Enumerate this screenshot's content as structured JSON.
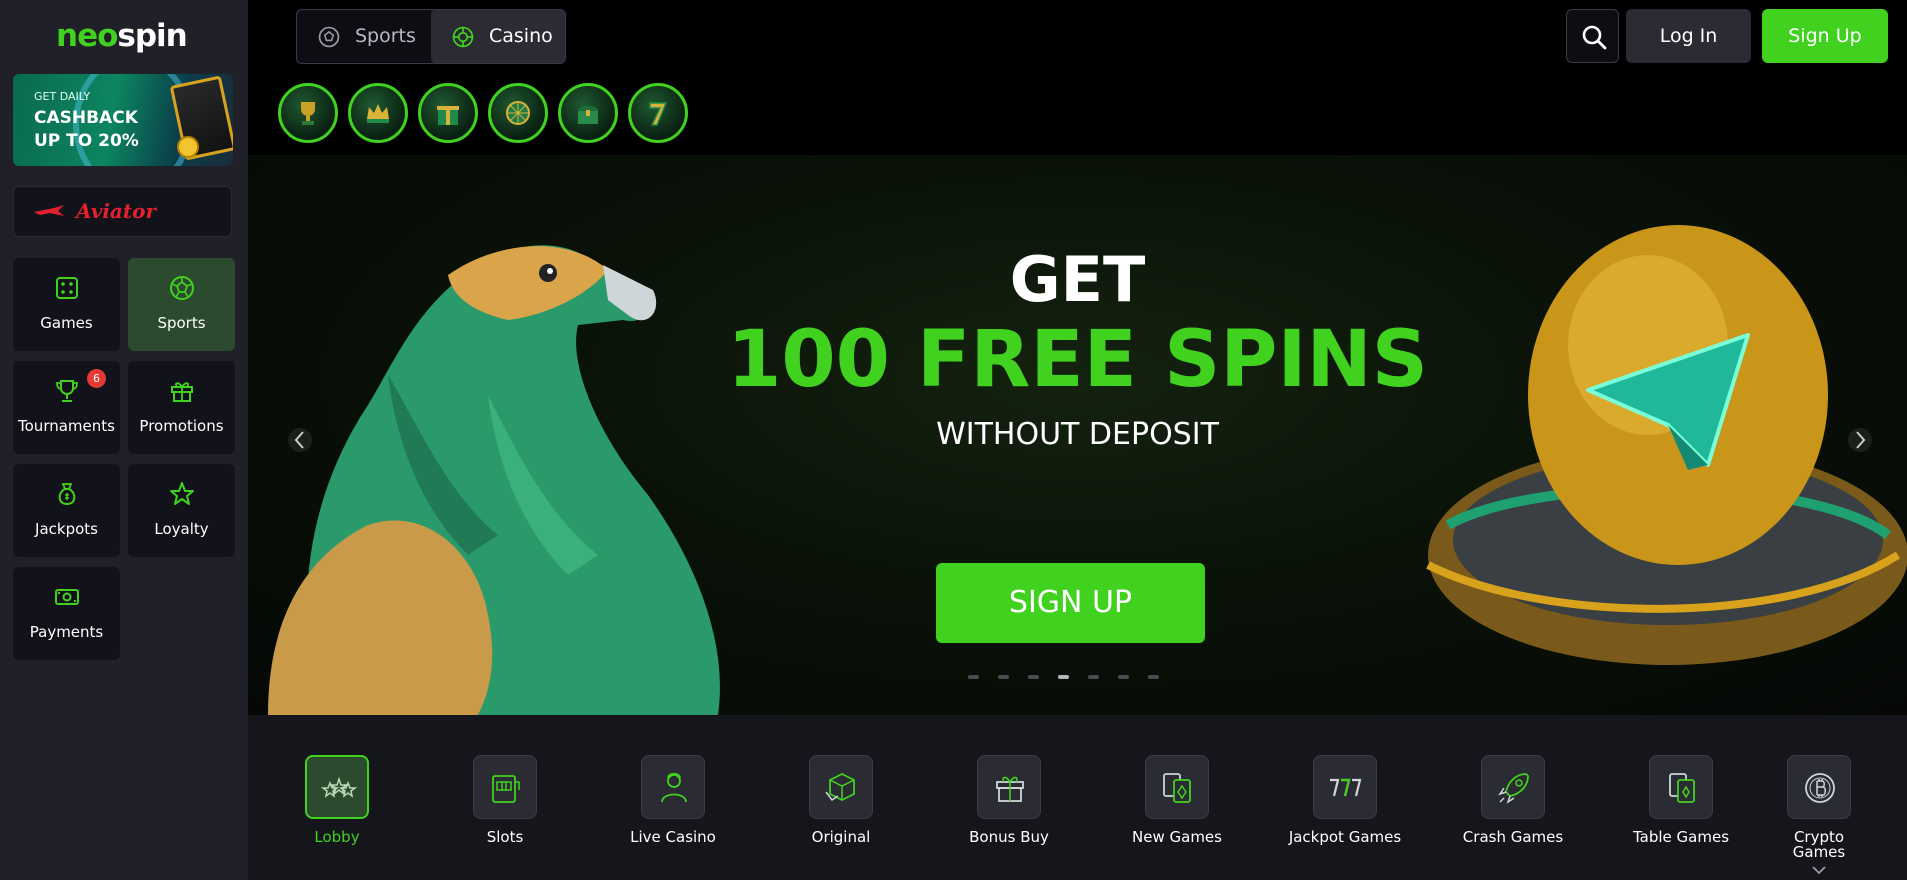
{
  "brand": {
    "part1": "neo",
    "part2": "spin"
  },
  "sidebar": {
    "cashback": {
      "line1": "GET DAILY",
      "line2": "CASHBACK",
      "line3": "UP TO 20%"
    },
    "aviator": "Aviator",
    "tiles": [
      {
        "label": "Games",
        "icon": "dice-icon"
      },
      {
        "label": "Sports",
        "icon": "soccer-ball-icon",
        "active": true
      },
      {
        "label": "Tournaments",
        "icon": "trophy-icon",
        "badge": "6"
      },
      {
        "label": "Promotions",
        "icon": "gift-icon"
      },
      {
        "label": "Jackpots",
        "icon": "money-bag-icon"
      },
      {
        "label": "Loyalty",
        "icon": "star-icon"
      },
      {
        "label": "Payments",
        "icon": "cash-icon"
      }
    ]
  },
  "header": {
    "switch": {
      "sports": "Sports",
      "casino": "Casino",
      "selected": "Casino"
    },
    "login": "Log In",
    "signup": "Sign Up"
  },
  "stories": [
    "trophy-story",
    "crown-story",
    "gift-story",
    "wheel-story",
    "chest-story",
    "seven-story"
  ],
  "hero": {
    "line1": "GET",
    "line2": "100 FREE SPINS",
    "line3": "WITHOUT DEPOSIT",
    "cta": "SIGN UP",
    "slides": 7,
    "active_slide": 4
  },
  "categories": [
    {
      "label": "Lobby",
      "active": true
    },
    {
      "label": "Slots"
    },
    {
      "label": "Live Casino"
    },
    {
      "label": "Original"
    },
    {
      "label": "Bonus Buy"
    },
    {
      "label": "New Games"
    },
    {
      "label": "Jackpot Games"
    },
    {
      "label": "Crash Games"
    },
    {
      "label": "Table Games"
    },
    {
      "label": "Crypto Games"
    }
  ],
  "colors": {
    "accent": "#41d11f",
    "sidebar": "#1f2028",
    "tile": "#12131a",
    "active_tile": "#2b4a2e"
  }
}
